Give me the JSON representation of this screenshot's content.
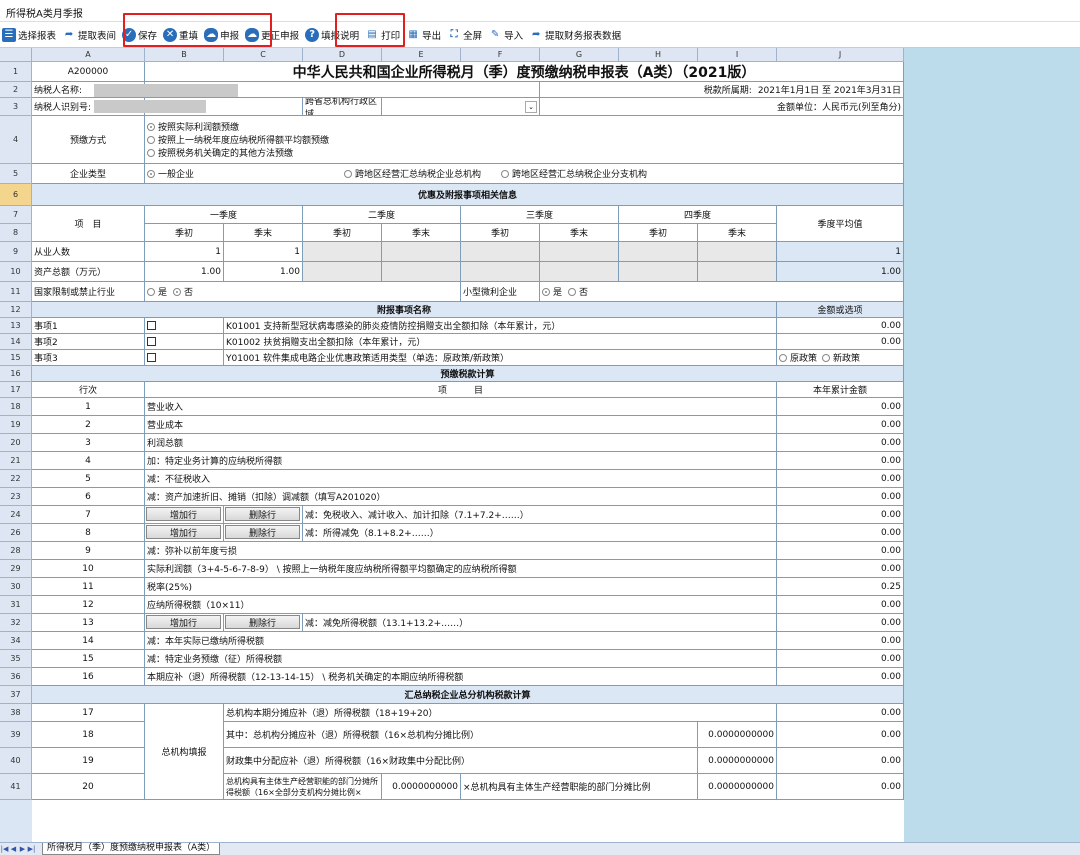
{
  "window": {
    "title": "所得税A类月季报"
  },
  "toolbar": {
    "select": "选择报表",
    "fetch": "提取表间",
    "save": "保存",
    "refill": "重填",
    "declare": "申报",
    "correct": "更正申报",
    "help": "填报说明",
    "print": "打印",
    "export": "导出",
    "fullscreen": "全屏",
    "import": "导入",
    "fetch_fin": "提取财务报表数据"
  },
  "columns": [
    "A",
    "B",
    "C",
    "D",
    "E",
    "F",
    "G",
    "H",
    "I",
    "J"
  ],
  "rows": [
    "1",
    "2",
    "3",
    "4",
    "5",
    "6",
    "7",
    "8",
    "9",
    "10",
    "11",
    "12",
    "13",
    "14",
    "15",
    "16",
    "17",
    "18",
    "19",
    "20",
    "21",
    "22",
    "23",
    "24",
    "26",
    "28",
    "29",
    "30",
    "31",
    "32",
    "34",
    "35",
    "36",
    "37",
    "38",
    "39",
    "40",
    "41"
  ],
  "form": {
    "code": "A200000",
    "title": "中华人民共和国企业所得税月（季）度预缴纳税申报表（A类）（2021版）",
    "taxpayer_name_label": "纳税人名称:",
    "period_label": "税款所属期:",
    "period_value": "2021年1月1日 至 2021年3月31日",
    "taxpayer_id_label": "纳税人识别号:",
    "region_label": "跨省总机构行政区域",
    "unit_label": "金额单位：人民币元(列至角分)",
    "prepay_label": "预缴方式",
    "prepay_opt1": "按照实际利润额预缴",
    "prepay_opt2": "按照上一纳税年度应纳税所得额平均额预缴",
    "prepay_opt3": "按照税务机关确定的其他方法预缴",
    "enterprise_type_label": "企业类型",
    "etype1": "一般企业",
    "etype2": "跨地区经营汇总纳税企业总机构",
    "etype3": "跨地区经营汇总纳税企业分支机构",
    "section_pref": "优惠及附报事项相关信息",
    "item_label": "项　目",
    "q1": "一季度",
    "q2": "二季度",
    "q3": "三季度",
    "q4": "四季度",
    "begin": "季初",
    "end": "季末",
    "avg": "季度平均值",
    "employees_label": "从业人数",
    "employees_b": "1",
    "employees_c": "1",
    "employees_avg": "1",
    "assets_label": "资产总额（万元）",
    "assets_b": "1.00",
    "assets_c": "1.00",
    "assets_avg": "1.00",
    "restricted_label": "国家限制或禁止行业",
    "yes": "是",
    "no": "否",
    "small_label": "小型微利企业",
    "attach_label": "附报事项名称",
    "amount_opt_label": "金额或选项",
    "ev1": "事项1",
    "ev1_text": "K01001 支持新型冠状病毒感染的肺炎疫情防控捐赠支出全额扣除（本年累计，元）",
    "ev1_val": "0.00",
    "ev2": "事项2",
    "ev2_text": "K01002 扶贫捐赠支出全额扣除（本年累计，元）",
    "ev2_val": "0.00",
    "ev3": "事项3",
    "ev3_text": "Y01001 软件集成电路企业优惠政策适用类型（单选：原政策/新政策）",
    "ev3_o1": "原政策",
    "ev3_o2": "新政策",
    "calc_label": "预缴税款计算",
    "lineno_label": "行次",
    "proj_label": "项　　　目",
    "ytd_label": "本年累计金额",
    "add_row": "增加行",
    "del_row": "删除行",
    "summary_label": "汇总纳税企业总分机构税款计算",
    "hq_label": "总机构填报",
    "ratio_val": "0.0000000000",
    "lines": [
      {
        "no": "1",
        "text": "营业收入",
        "val": "0.00"
      },
      {
        "no": "2",
        "text": "营业成本",
        "val": "0.00"
      },
      {
        "no": "3",
        "text": "利润总额",
        "val": "0.00"
      },
      {
        "no": "4",
        "text": "加：特定业务计算的应纳税所得额",
        "val": "0.00"
      },
      {
        "no": "5",
        "text": "减：不征税收入",
        "val": "0.00"
      },
      {
        "no": "6",
        "text": "减：资产加速折旧、摊销（扣除）调减额（填写A201020）",
        "val": "0.00"
      },
      {
        "no": "7",
        "text": "减：免税收入、减计收入、加计扣除（7.1+7.2+……）",
        "val": "0.00"
      },
      {
        "no": "8",
        "text": "减：所得减免（8.1+8.2+……）",
        "val": "0.00"
      },
      {
        "no": "9",
        "text": "减：弥补以前年度亏损",
        "val": "0.00"
      },
      {
        "no": "10",
        "text": "实际利润额（3+4-5-6-7-8-9） \\ 按照上一纳税年度应纳税所得额平均额确定的应纳税所得额",
        "val": "0.00"
      },
      {
        "no": "11",
        "text": "税率(25%)",
        "val": "0.25"
      },
      {
        "no": "12",
        "text": "应纳所得税额（10×11）",
        "val": "0.00"
      },
      {
        "no": "13",
        "text": "减：减免所得税额（13.1+13.2+……）",
        "val": "0.00"
      },
      {
        "no": "14",
        "text": "减：本年实际已缴纳所得税额",
        "val": "0.00"
      },
      {
        "no": "15",
        "text": "减：特定业务预缴（征）所得税额",
        "val": "0.00"
      },
      {
        "no": "16",
        "text": "本期应补（退）所得税额（12-13-14-15） \\ 税务机关确定的本期应纳所得税额",
        "val": "0.00"
      },
      {
        "no": "17",
        "text": "总机构本期分摊应补（退）所得税额（18+19+20）",
        "val": "0.00"
      },
      {
        "no": "18",
        "text": "其中：总机构分摊应补（退）所得税额（16×总机构分摊比例）",
        "val": "0.00"
      },
      {
        "no": "19",
        "text": "财政集中分配应补（退）所得税额（16×财政集中分配比例）",
        "val": "0.00"
      },
      {
        "no": "20",
        "text": "总机构具有主体生产经营职能的部门分摊所得税额（16×全部分支机构分摊比例×",
        "val": "0.00"
      }
    ],
    "line20_mid": "×总机构具有主体生产经营职能的部门分摊比例"
  },
  "sheet_tab": "所得税月（季）度预缴纳税申报表（A类）",
  "colors": {
    "accent": "#2a6ebb",
    "highlight": "#e02020"
  }
}
